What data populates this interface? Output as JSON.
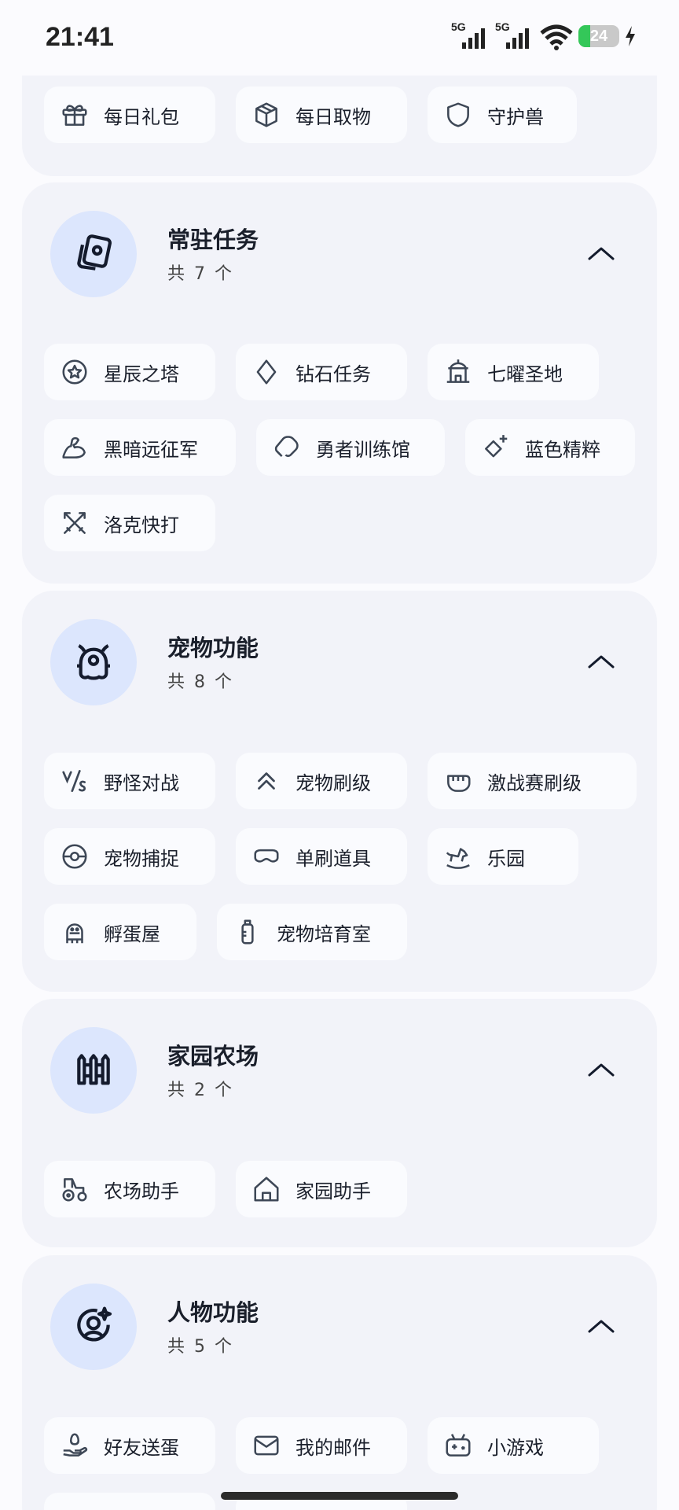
{
  "status": {
    "time": "21:41",
    "network1": "5G",
    "network2": "5G",
    "battery": "24"
  },
  "top_partial": {
    "chips": [
      "每日礼包",
      "每日取物",
      "守护兽"
    ]
  },
  "sections": [
    {
      "title": "常驻任务",
      "count_prefix": "共",
      "count": "7",
      "count_suffix": "个",
      "icon": "cards-icon",
      "chips": [
        "星辰之塔",
        "钻石任务",
        "七曜圣地",
        "黑暗远征军",
        "勇者训练馆",
        "蓝色精粹",
        "洛克快打"
      ]
    },
    {
      "title": "宠物功能",
      "count_prefix": "共",
      "count": "8",
      "count_suffix": "个",
      "icon": "pet-icon",
      "chips": [
        "野怪对战",
        "宠物刷级",
        "激战赛刷级",
        "宠物捕捉",
        "单刷道具",
        "乐园",
        "孵蛋屋",
        "宠物培育室"
      ]
    },
    {
      "title": "家园农场",
      "count_prefix": "共",
      "count": "2",
      "count_suffix": "个",
      "icon": "fence-icon",
      "chips": [
        "农场助手",
        "家园助手"
      ]
    },
    {
      "title": "人物功能",
      "count_prefix": "共",
      "count": "5",
      "count_suffix": "个",
      "icon": "user-sparkle-icon",
      "chips": [
        "好友送蛋",
        "我的邮件",
        "小游戏"
      ]
    }
  ]
}
